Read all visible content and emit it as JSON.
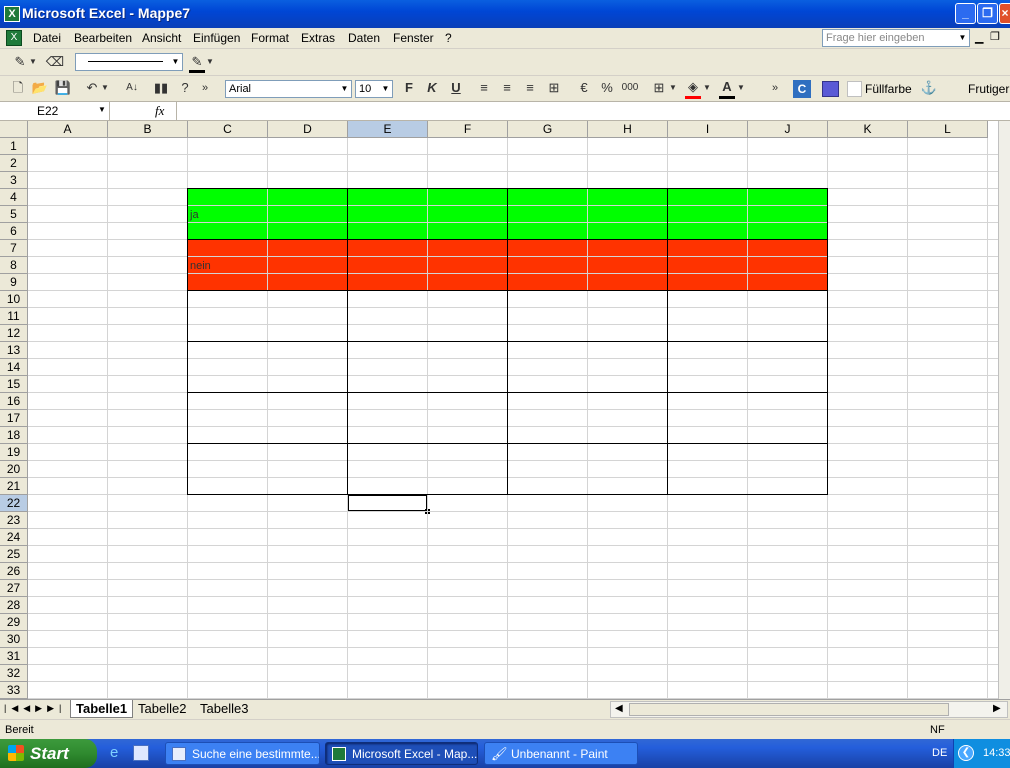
{
  "window": {
    "title": "Microsoft Excel - Mappe7"
  },
  "menu": {
    "items": [
      "Datei",
      "Bearbeiten",
      "Ansicht",
      "Einfügen",
      "Format",
      "Extras",
      "Daten",
      "Fenster",
      "?"
    ],
    "help_placeholder": "Frage hier eingeben"
  },
  "toolbar": {
    "font_name": "Arial",
    "font_size": "10",
    "bold": "F",
    "italic": "K",
    "underline": "U",
    "percent": "%",
    "thousands": "000",
    "fill_label": "Füllfarbe",
    "style_label": "Frutiger"
  },
  "formula_bar": {
    "name_box": "E22",
    "fx": "fx",
    "formula": ""
  },
  "grid": {
    "columns": [
      "A",
      "B",
      "C",
      "D",
      "E",
      "F",
      "G",
      "H",
      "I",
      "J",
      "K",
      "L"
    ],
    "rows": [
      "1",
      "2",
      "3",
      "4",
      "5",
      "6",
      "7",
      "8",
      "9",
      "10",
      "11",
      "12",
      "13",
      "14",
      "15",
      "16",
      "17",
      "18",
      "19",
      "20",
      "21",
      "22",
      "23",
      "24",
      "25",
      "26",
      "27",
      "28",
      "29",
      "30",
      "31",
      "32",
      "33"
    ],
    "selected_cell": "E22",
    "cells": {
      "C5": "ja",
      "C8": "nein"
    },
    "colors": {
      "green_band": "#00ff00",
      "red_band": "#ff3300"
    }
  },
  "sheets": {
    "tabs": [
      "Tabelle1",
      "Tabelle2",
      "Tabelle3"
    ],
    "active": "Tabelle1"
  },
  "status": {
    "left": "Bereit",
    "right": "NF"
  },
  "taskbar": {
    "start": "Start",
    "tasks": [
      "Suche eine bestimmte...",
      "Microsoft Excel - Map...",
      "Unbenannt - Paint"
    ],
    "lang": "DE",
    "clock": "14:33"
  }
}
